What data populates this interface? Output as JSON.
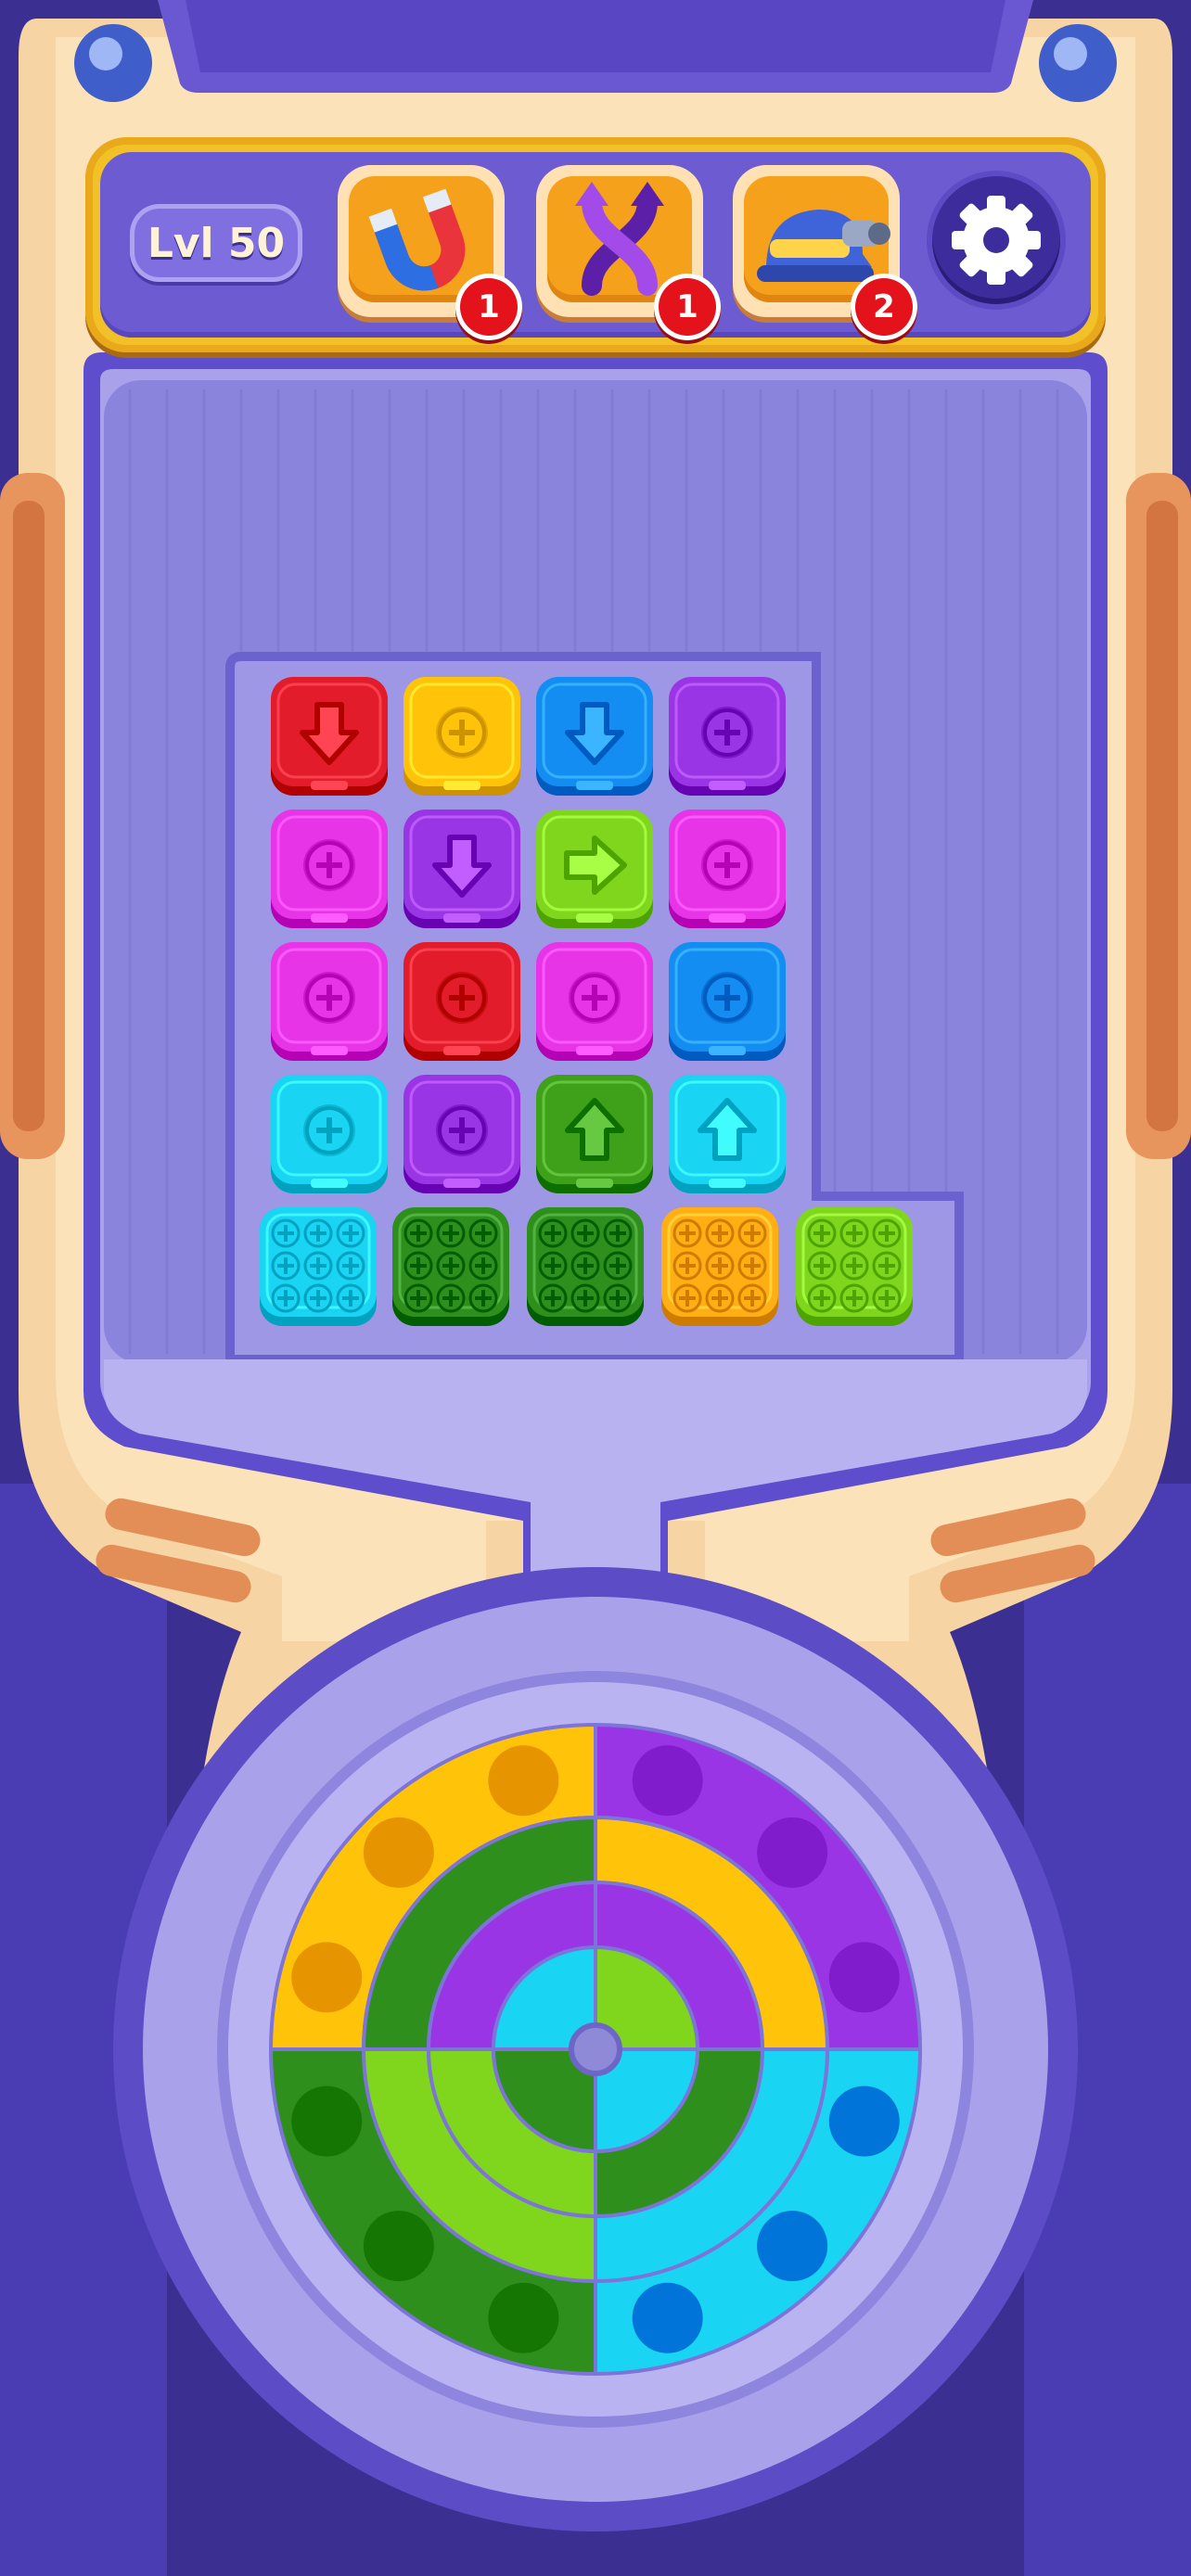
{
  "level": {
    "label": "Lvl 50"
  },
  "boosters": [
    {
      "name": "magnet",
      "count": "1",
      "icon": "magnet-icon"
    },
    {
      "name": "twist-swap",
      "count": "1",
      "icon": "twist-arrows-icon"
    },
    {
      "name": "hard-hat-drill",
      "count": "2",
      "icon": "hard-hat-icon"
    }
  ],
  "settings": {
    "icon": "gear-icon"
  },
  "colors": {
    "red": "#e21c2b",
    "yellow": "#ffc40a",
    "blue": "#138df2",
    "purple": "#9a35e6",
    "magenta": "#e634e6",
    "lime": "#7fd61c",
    "green": "#3fa11a",
    "cyan": "#19d4f2",
    "orange": "#ffae14",
    "darkgreen": "#2f8f1d"
  },
  "board": {
    "tiles": [
      {
        "row": 0,
        "col": 0,
        "color": "red",
        "symbol": "arrow-down"
      },
      {
        "row": 0,
        "col": 1,
        "color": "yellow",
        "symbol": "screw"
      },
      {
        "row": 0,
        "col": 2,
        "color": "blue",
        "symbol": "arrow-down"
      },
      {
        "row": 0,
        "col": 3,
        "color": "purple",
        "symbol": "screw"
      },
      {
        "row": 1,
        "col": 0,
        "color": "magenta",
        "symbol": "screw"
      },
      {
        "row": 1,
        "col": 1,
        "color": "purple",
        "symbol": "arrow-down"
      },
      {
        "row": 1,
        "col": 2,
        "color": "lime",
        "symbol": "arrow-right"
      },
      {
        "row": 1,
        "col": 3,
        "color": "magenta",
        "symbol": "screw"
      },
      {
        "row": 2,
        "col": 0,
        "color": "magenta",
        "symbol": "screw"
      },
      {
        "row": 2,
        "col": 1,
        "color": "red",
        "symbol": "screw"
      },
      {
        "row": 2,
        "col": 2,
        "color": "magenta",
        "symbol": "screw"
      },
      {
        "row": 2,
        "col": 3,
        "color": "blue",
        "symbol": "screw"
      },
      {
        "row": 3,
        "col": 0,
        "color": "cyan",
        "symbol": "screw"
      },
      {
        "row": 3,
        "col": 1,
        "color": "purple",
        "symbol": "screw"
      },
      {
        "row": 3,
        "col": 2,
        "color": "green",
        "symbol": "arrow-up"
      },
      {
        "row": 3,
        "col": 3,
        "color": "cyan",
        "symbol": "arrow-up"
      },
      {
        "row": 4,
        "col": 0,
        "color": "cyan",
        "symbol": "screw-grid"
      },
      {
        "row": 4,
        "col": 1,
        "color": "darkgreen",
        "symbol": "screw-grid"
      },
      {
        "row": 4,
        "col": 2,
        "color": "darkgreen",
        "symbol": "screw-grid"
      },
      {
        "row": 4,
        "col": 3,
        "color": "orange",
        "symbol": "screw-grid"
      },
      {
        "row": 4,
        "col": 4,
        "color": "lime",
        "symbol": "screw-grid"
      }
    ]
  },
  "wheel": {
    "quadrants": [
      {
        "position": "top-left",
        "rings": [
          "darkgreen",
          "purple",
          "cyan"
        ],
        "outer": "yellow",
        "slots": 3,
        "slot_color": "orange"
      },
      {
        "position": "top-right",
        "rings": [
          "yellow",
          "purple",
          "lime"
        ],
        "outer": "purple",
        "slots": 3,
        "slot_color": "purple"
      },
      {
        "position": "bottom-left",
        "rings": [
          "lime",
          "lime",
          "darkgreen"
        ],
        "outer": "darkgreen",
        "slots": 3,
        "slot_color": "darkgreen"
      },
      {
        "position": "bottom-right",
        "rings": [
          "cyan",
          "darkgreen",
          "cyan"
        ],
        "outer": "cyan",
        "slots": 3,
        "slot_color": "blue"
      }
    ]
  }
}
